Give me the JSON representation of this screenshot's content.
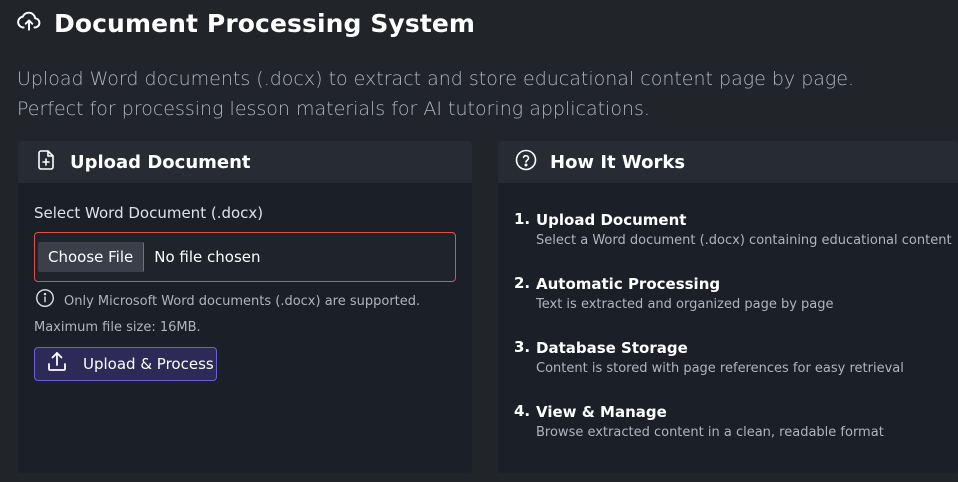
{
  "header": {
    "title": "Document Processing System",
    "icon": "cloud-upload-icon"
  },
  "lead": "Upload Word documents (.docx) to extract and store educational content page by page. Perfect for processing lesson materials for AI tutoring applications.",
  "upload_card": {
    "title": "Upload Document",
    "icon": "file-plus-icon",
    "field_label": "Select Word Document (.docx)",
    "choose_label": "Choose File",
    "file_status": "No file chosen",
    "hint_line1": "Only Microsoft Word documents (.docx) are supported.",
    "hint_line2": "Maximum file size: 16MB.",
    "button_label": "Upload & Process"
  },
  "how_card": {
    "title": "How It Works",
    "icon": "question-circle-icon",
    "steps": [
      {
        "num": "1.",
        "title": "Upload Document",
        "desc": "Select a Word document (.docx) containing educational content"
      },
      {
        "num": "2.",
        "title": "Automatic Processing",
        "desc": "Text is extracted and organized page by page"
      },
      {
        "num": "3.",
        "title": "Database Storage",
        "desc": "Content is stored with page references for easy retrieval"
      },
      {
        "num": "4.",
        "title": "View & Manage",
        "desc": "Browse extracted content in a clean, readable format"
      }
    ]
  },
  "colors": {
    "background": "#212529",
    "card": "#1b1f27",
    "card_header": "#262b34",
    "accent": "#6f5fd4",
    "error_border": "#d9534f"
  }
}
